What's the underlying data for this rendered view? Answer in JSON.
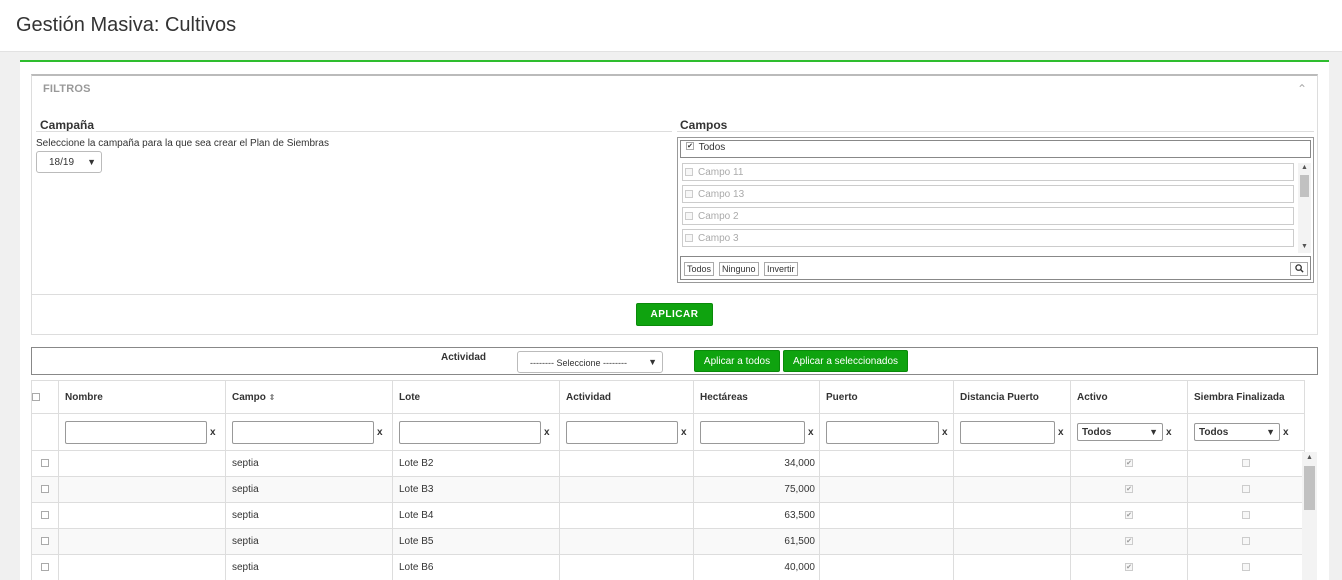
{
  "page": {
    "title": "Gestión Masiva: Cultivos"
  },
  "filters": {
    "header": "FILTROS",
    "campaign": {
      "title": "Campaña",
      "description": "Seleccione la campaña para la que sea crear el Plan de Siembras",
      "selected": "18/19"
    },
    "fields": {
      "title": "Campos",
      "all_label": "Todos",
      "items": [
        "Campo 11",
        "Campo 13",
        "Campo 2",
        "Campo 3"
      ],
      "buttons": {
        "all": "Todos",
        "none": "Ninguno",
        "invert": "Invertir"
      }
    },
    "apply_label": "APLICAR"
  },
  "activity_bar": {
    "label": "Actividad",
    "select_placeholder": "-------- Seleccione --------",
    "apply_all": "Aplicar a todos",
    "apply_selected": "Aplicar a seleccionados"
  },
  "grid": {
    "columns": [
      "Nombre",
      "Campo",
      "Lote",
      "Actividad",
      "Hectáreas",
      "Puerto",
      "Distancia Puerto",
      "Activo",
      "Siembra Finalizada"
    ],
    "filter_select_value": "Todos",
    "clear_symbol": "x",
    "rows": [
      {
        "nombre": "",
        "campo": "septia",
        "lote": "Lote B2",
        "actividad": "",
        "hectareas": "34,000",
        "puerto": "",
        "distancia": "",
        "activo": true,
        "finalizada": false
      },
      {
        "nombre": "",
        "campo": "septia",
        "lote": "Lote B3",
        "actividad": "",
        "hectareas": "75,000",
        "puerto": "",
        "distancia": "",
        "activo": true,
        "finalizada": false
      },
      {
        "nombre": "",
        "campo": "septia",
        "lote": "Lote B4",
        "actividad": "",
        "hectareas": "63,500",
        "puerto": "",
        "distancia": "",
        "activo": true,
        "finalizada": false
      },
      {
        "nombre": "",
        "campo": "septia",
        "lote": "Lote B5",
        "actividad": "",
        "hectareas": "61,500",
        "puerto": "",
        "distancia": "",
        "activo": true,
        "finalizada": false
      },
      {
        "nombre": "",
        "campo": "septia",
        "lote": "Lote B6",
        "actividad": "",
        "hectareas": "40,000",
        "puerto": "",
        "distancia": "",
        "activo": true,
        "finalizada": false
      }
    ]
  },
  "icons": {
    "collapse": "chevron-up-icon",
    "sort": "sort-icon",
    "search": "search-icon",
    "check": "check-icon"
  }
}
